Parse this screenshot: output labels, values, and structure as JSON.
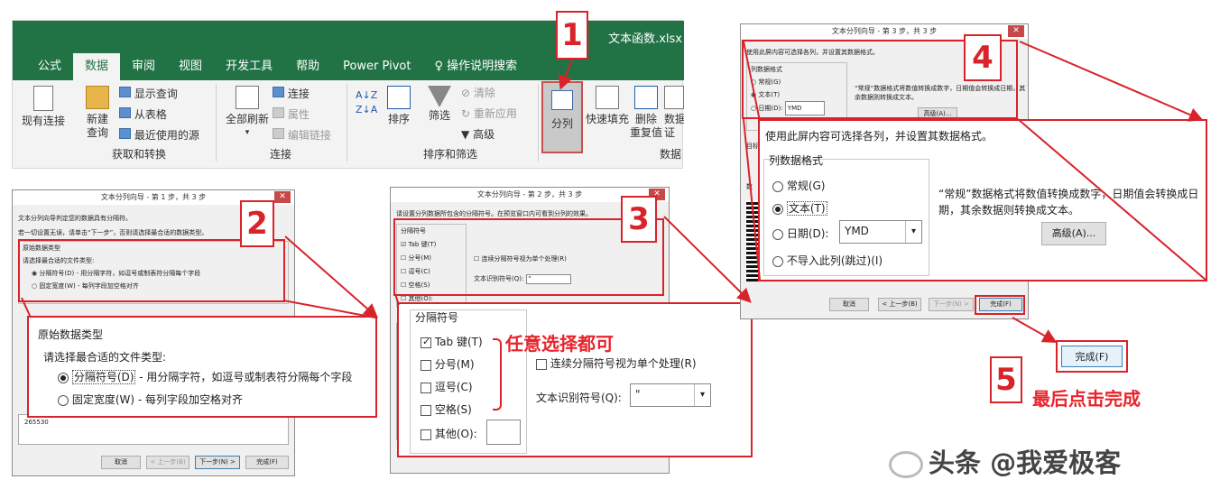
{
  "ribbon": {
    "file_title": "文本函数.xlsx",
    "tabs": [
      "公式",
      "数据",
      "审阅",
      "视图",
      "开发工具",
      "帮助",
      "Power Pivot"
    ],
    "active_tab": "数据",
    "search_label": "操作说明搜索",
    "btn_existing": "现有连接",
    "btn_newquery_1": "新建",
    "btn_newquery_2": "查询",
    "btn_show_query": "显示查询",
    "btn_from_table": "从表格",
    "btn_recent_sources": "最近使用的源",
    "group_get_transform": "获取和转换",
    "btn_refresh_all_1": "全部刷新",
    "btn_connections": "连接",
    "btn_properties": "属性",
    "btn_edit_links": "编辑链接",
    "group_connections": "连接",
    "btn_sort": "排序",
    "btn_filter": "筛选",
    "btn_clear": "清除",
    "btn_reapply": "重新应用",
    "btn_advanced": "高级",
    "group_sort_filter": "排序和筛选",
    "btn_split": "分列",
    "btn_flash_fill": "快速填充",
    "btn_remove_dup_1": "删除",
    "btn_remove_dup_2": "重复值",
    "btn_validation_1": "数据",
    "btn_validation_2": "证",
    "group_data_tools": "数据"
  },
  "step1": {
    "title": "文本分列向导 - 第 1 步，共 3 步",
    "intro1": "文本分列向导判定您的数据具有分隔符。",
    "intro2": "若一切设置无误，请单击“下一步”，否则请选择最合适的数据类型。",
    "group_label": "原始数据类型",
    "prompt": "请选择最合适的文件类型:",
    "opt_delimited": "分隔符号(D)",
    "opt_delimited_desc": "- 用分隔字符，如逗号或制表符分隔每个字段",
    "opt_fixed": "固定宽度(W)",
    "opt_fixed_desc": "- 每列字段加空格对齐",
    "preview_value": "265530",
    "btn_cancel": "取消",
    "btn_back": "< 上一步(B)",
    "btn_next": "下一步(N) >",
    "btn_finish": "完成(F)"
  },
  "step2": {
    "title": "文本分列向导 - 第 2 步，共 3 步",
    "intro": "请设置分列数据所包含的分隔符号。在预览窗口内可看到分列的效果。",
    "group_label": "分隔符号",
    "tab": "Tab 键(T)",
    "semicolon": "分号(M)",
    "comma": "逗号(C)",
    "space": "空格(S)",
    "other": "其他(O):",
    "consecutive": "连续分隔符号视为单个处理(R)",
    "qualifier_label": "文本识别符号(Q):",
    "qualifier_value": "\"",
    "annotation": "任意选择都可"
  },
  "step3": {
    "title": "文本分列向导 - 第 3 步，共 3 步",
    "intro": "使用此屏内容可选择各列，并设置其数据格式。",
    "group_label": "列数据格式",
    "opt_general": "常规(G)",
    "opt_text": "文本(T)",
    "opt_date": "日期(D):",
    "date_value": "YMD",
    "opt_skip": "不导入此列(跳过)(I)",
    "desc": "“常规”数据格式将数值转换成数字，日期值会转换成日期，其余数据则转换成文本。",
    "btn_advanced": "高级(A)...",
    "btn_cancel": "取消",
    "btn_back": "< 上一步(B)",
    "btn_next": "下一步(N) >",
    "btn_finish": "完成(F)",
    "side_target": "目标",
    "side_data": "数"
  },
  "finish_zoom": {
    "btn_finish": "完成(F)",
    "annotation": "最后点击完成"
  },
  "badges": [
    "1",
    "2",
    "3",
    "4",
    "5"
  ],
  "watermark": "头条 @我爱极客",
  "colors": {
    "excel_green": "#217346",
    "annotation_red": "#d9232a"
  }
}
